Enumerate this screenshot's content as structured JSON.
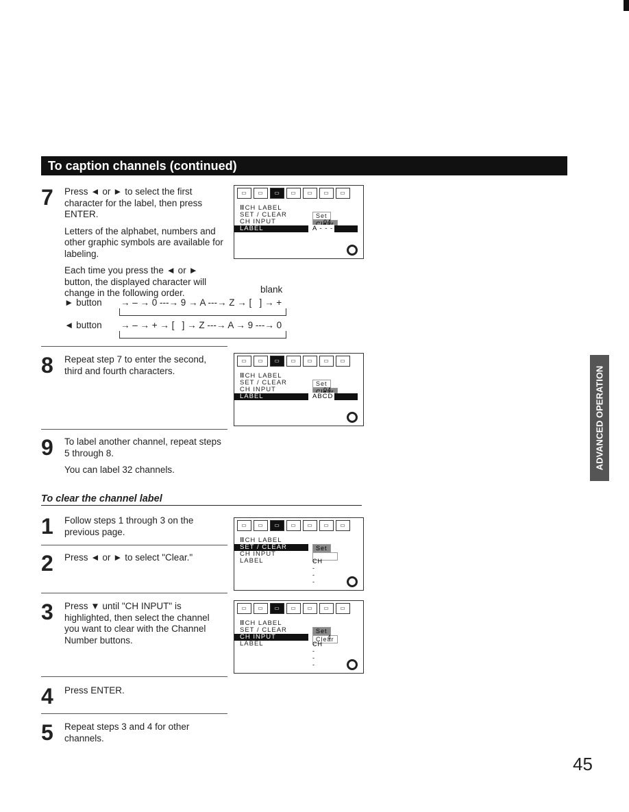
{
  "header": "To caption channels (continued)",
  "steps_a": [
    {
      "num": "7",
      "paras": [
        "Press ◄ or ► to select the first character for the label, then press ENTER.",
        "Letters of the alphabet, numbers and other graphic symbols are available for labeling.",
        "Each time you press the ◄ or ► button, the displayed character will change in the following order."
      ]
    },
    {
      "num": "8",
      "paras": [
        "Repeat step 7 to enter the second, third and fourth characters."
      ]
    },
    {
      "num": "9",
      "paras": [
        "To label another channel, repeat steps 5 through 8.",
        "You can label 32 channels."
      ]
    }
  ],
  "order": {
    "blank": "blank",
    "right_label": "► button",
    "right_seq": "→ – → 0 ---→ 9 → A ---→ Z → [   ] → +",
    "left_label": "◄ button",
    "left_seq": "→ – → + → [   ] → Z ---→ A → 9 ---→ 0"
  },
  "clear_title": "To clear the channel label",
  "steps_b": [
    {
      "num": "1",
      "paras": [
        "Follow steps 1 through 3 on the previous page."
      ]
    },
    {
      "num": "2",
      "paras": [
        "Press ◄ or ► to select \"Clear.\""
      ]
    },
    {
      "num": "3",
      "paras": [
        "Press ▼ until \"CH INPUT\" is highlighted, then select the channel you want to clear with the Channel Number buttons."
      ]
    },
    {
      "num": "4",
      "paras": [
        "Press ENTER."
      ]
    },
    {
      "num": "5",
      "paras": [
        "Repeat steps 3 and 4 for other channels."
      ]
    }
  ],
  "osd": {
    "icons": [
      "picture",
      "audio",
      "ch",
      "surround",
      "wide",
      "lock",
      "cc"
    ],
    "active_icon": 2,
    "title": "CH LABEL",
    "rows": [
      "SET / CLEAR",
      "CH  INPUT",
      "LABEL"
    ],
    "set": "Set",
    "clear": "Clear",
    "ch_suffix": "CH",
    "screens": [
      {
        "highlight": 2,
        "selected": "Clear",
        "ch": "04",
        "label": "A - - -"
      },
      {
        "highlight": 2,
        "selected": "Clear",
        "ch": "04",
        "label": "ABCD"
      },
      {
        "highlight": 0,
        "selected": "Set",
        "ch": "",
        "label": "- - - -"
      },
      {
        "highlight": 1,
        "selected": "Set",
        "ch": "4",
        "label": "- - - -"
      }
    ]
  },
  "side_tab": "ADVANCED OPERATION",
  "page_number": "45"
}
